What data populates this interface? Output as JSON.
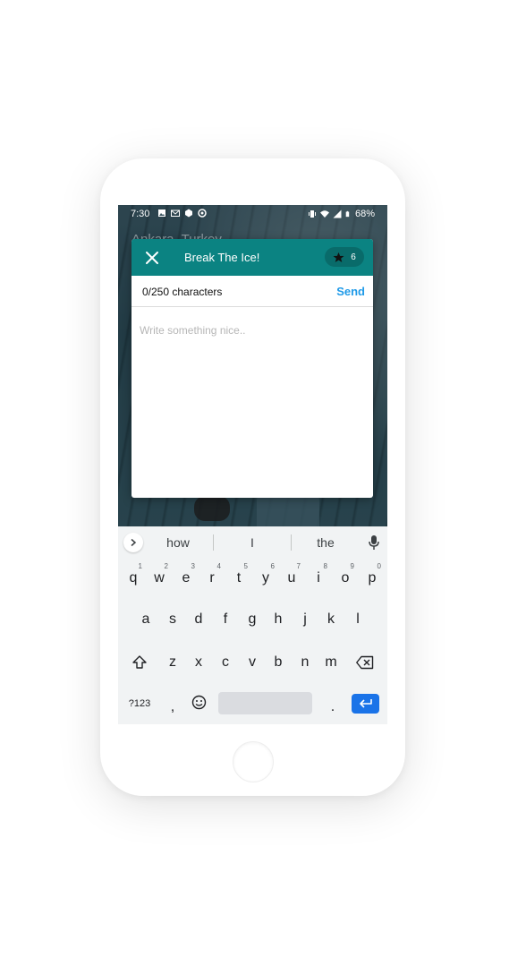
{
  "status_bar": {
    "time": "7:30",
    "battery": "68%",
    "icons": [
      "image-icon",
      "email-icon",
      "app-icon",
      "sync-icon",
      "vibrate-icon",
      "wifi-icon",
      "signal-icon",
      "battery-icon"
    ]
  },
  "background": {
    "location": "Ankara, Turkey"
  },
  "dialog": {
    "title": "Break The Ice!",
    "credits": "6",
    "char_count": "0/250 characters",
    "send_label": "Send",
    "placeholder": "Write something nice..",
    "header_color": "#0b8382",
    "send_color": "#1f9ae8"
  },
  "keyboard": {
    "suggestions": [
      "how",
      "I",
      "the"
    ],
    "row1": [
      "q",
      "w",
      "e",
      "r",
      "t",
      "y",
      "u",
      "i",
      "o",
      "p"
    ],
    "row1_hints": [
      "1",
      "2",
      "3",
      "4",
      "5",
      "6",
      "7",
      "8",
      "9",
      "0"
    ],
    "row2": [
      "a",
      "s",
      "d",
      "f",
      "g",
      "h",
      "j",
      "k",
      "l"
    ],
    "row3": [
      "z",
      "x",
      "c",
      "v",
      "b",
      "n",
      "m"
    ],
    "symbols_label": "?123",
    "comma": ",",
    "period": ".",
    "enter_color": "#1a73e8"
  }
}
